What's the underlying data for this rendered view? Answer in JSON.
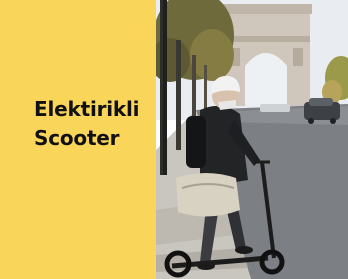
{
  "banner": {
    "headline_line1": "Elektirikli",
    "headline_line2": "Scooter",
    "accent_color": "#f9d65a",
    "text_color": "#111111",
    "photo_subject": "rider-with-helmet-on-electric-scooter-near-arc-de-triomphe"
  }
}
